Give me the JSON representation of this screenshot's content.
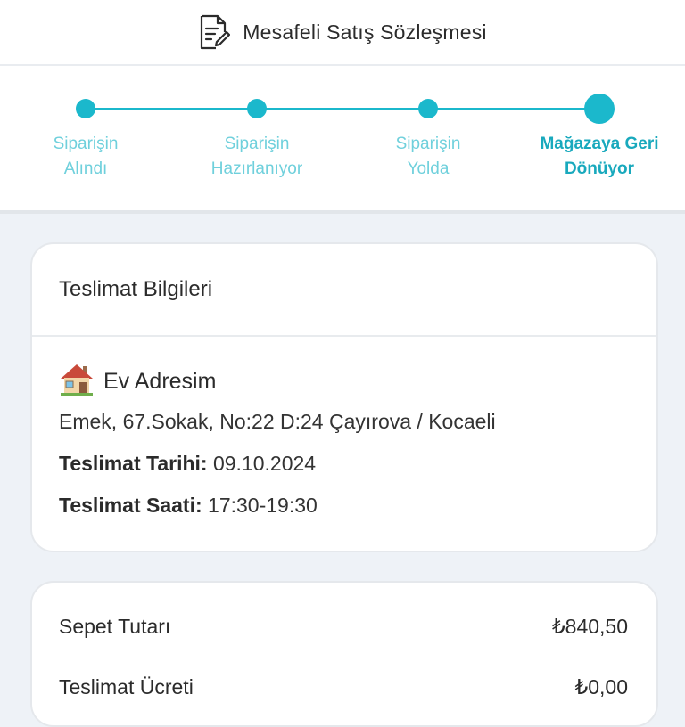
{
  "header": {
    "contract_label": "Mesafeli Satış Sözleşmesi",
    "icon": "document-edit-icon"
  },
  "tracker": {
    "steps": [
      {
        "label": "Siparişin\nAlındı",
        "status": "done"
      },
      {
        "label": "Siparişin\nHazırlanıyor",
        "status": "done"
      },
      {
        "label": "Siparişin\nYolda",
        "status": "done"
      },
      {
        "label": "Mağazaya Geri\nDönüyor",
        "status": "current"
      }
    ],
    "accent_color": "#1bb8cc"
  },
  "delivery": {
    "title": "Teslimat Bilgileri",
    "address_icon": "house-icon",
    "address_name": "Ev Adresim",
    "address_line": "Emek, 67.Sokak, No:22 D:24 Çayırova / Kocaeli",
    "date_label": "Teslimat Tarihi:",
    "date_value": "09.10.2024",
    "time_label": "Teslimat Saati:",
    "time_value": "17:30-19:30"
  },
  "summary": {
    "rows": [
      {
        "label": "Sepet Tutarı",
        "value": "₺840,50"
      },
      {
        "label": "Teslimat Ücreti",
        "value": "₺0,00"
      }
    ]
  }
}
